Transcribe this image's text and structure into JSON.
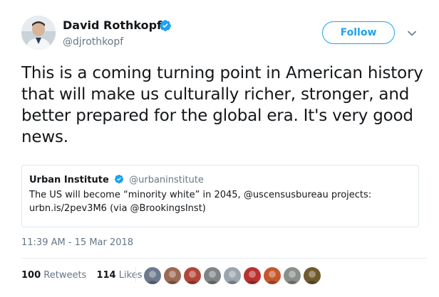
{
  "author": {
    "name": "David Rothkopf",
    "handle": "@djrothkopf",
    "verified_icon": "verified-badge-icon",
    "avatar_icon": "avatar-photo"
  },
  "follow_button": {
    "label": "Follow"
  },
  "menu_icon": "chevron-down-icon",
  "tweet": {
    "text": "This is a coming turning point in American history that will make us culturally richer, stronger, and better prepared for the global era.  It's very good news."
  },
  "quoted_tweet": {
    "name": "Urban Institute",
    "handle": "@urbaninstitute",
    "text": "The US will become “minority white” in 2045, @uscensusbureau projects: urbn.is/2pev3M6 (via @BrookingsInst)"
  },
  "timestamp": "11:39 AM - 15 Mar 2018",
  "stats": {
    "retweets_count": "100",
    "retweets_label": "Retweets",
    "likes_count": "114",
    "likes_label": "Likes"
  },
  "colors": {
    "accent": "#1da1f2",
    "muted": "#657786",
    "text": "#14171a",
    "border": "#e1e8ed"
  },
  "likers": [
    {
      "name": "liker-avatar-1",
      "color": "#6b7a8c"
    },
    {
      "name": "liker-avatar-2",
      "color": "#9a6a55"
    },
    {
      "name": "liker-avatar-3",
      "color": "#b2463a"
    },
    {
      "name": "liker-avatar-4",
      "color": "#7f8486"
    },
    {
      "name": "liker-avatar-5",
      "color": "#9aa5ae"
    },
    {
      "name": "liker-avatar-6",
      "color": "#b8322f"
    },
    {
      "name": "liker-avatar-7",
      "color": "#c4582c"
    },
    {
      "name": "liker-avatar-8",
      "color": "#8b8f8a"
    },
    {
      "name": "liker-avatar-9",
      "color": "#6e5a2e"
    }
  ]
}
